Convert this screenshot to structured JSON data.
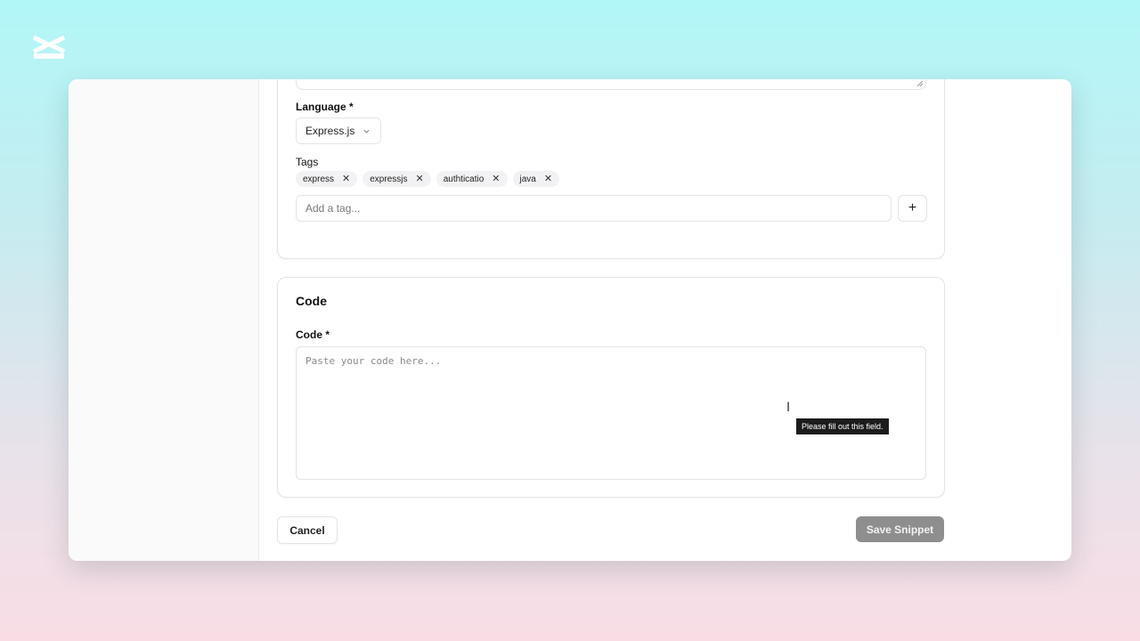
{
  "form": {
    "language": {
      "label": "Language *",
      "selected": "Express.js"
    },
    "tags": {
      "label": "Tags",
      "items": [
        {
          "label": "express"
        },
        {
          "label": "expressjs"
        },
        {
          "label": "authticatio"
        },
        {
          "label": "java"
        }
      ],
      "remove_glyph": "✕",
      "input_placeholder": "Add a tag...",
      "add_glyph": "+"
    },
    "code_section": {
      "title": "Code",
      "label": "Code *",
      "placeholder": "Paste your code here..."
    },
    "validation_tooltip": "Please fill out this field.",
    "actions": {
      "cancel": "Cancel",
      "save": "Save Snippet"
    }
  },
  "colors": {
    "save_button_disabled": "#8e8e8e",
    "tooltip_bg": "#1c1c1c"
  },
  "icons": {
    "chevron": "chevron-down-icon",
    "cursor": "text-cursor-icon"
  }
}
